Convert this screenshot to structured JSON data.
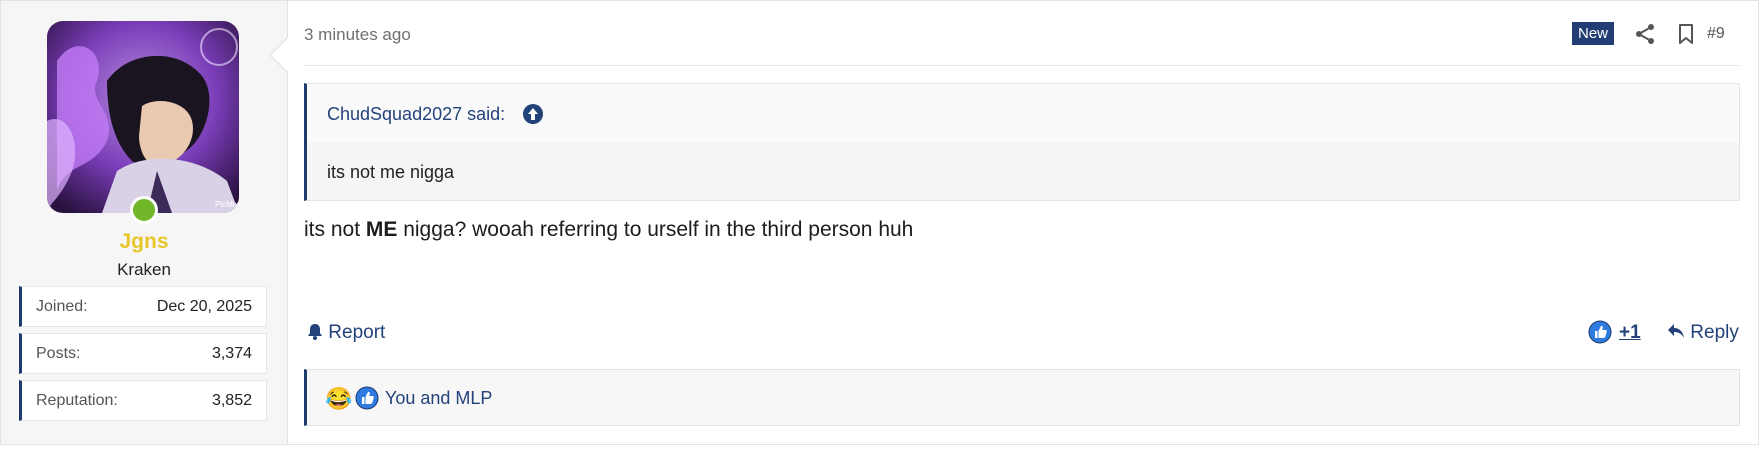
{
  "author": {
    "username": "Jgns",
    "title": "Kraken",
    "avatar_watermark": "PicMix",
    "online_color": "#72b629",
    "stats": [
      {
        "label": "Joined:",
        "value": "Dec 20, 2025"
      },
      {
        "label": "Posts:",
        "value": "3,374"
      },
      {
        "label": "Reputation:",
        "value": "3,852"
      }
    ]
  },
  "post": {
    "time": "3 minutes ago",
    "new_badge": "New",
    "number": "#9",
    "quote": {
      "author_said": "ChudSquad2027 said:",
      "text": "its not me nigga"
    },
    "message": {
      "before": "its not ",
      "bold": "ME",
      "after": " nigga? wooah referring to urself in the third person huh"
    },
    "actions": {
      "report": "Report",
      "like_count": "+1",
      "reply": "Reply"
    },
    "reactions": {
      "emoji": "😂",
      "text": "You and MLP"
    }
  },
  "colors": {
    "accent": "#1d3b6e",
    "link": "#23427a",
    "username": "#e8c52a"
  }
}
